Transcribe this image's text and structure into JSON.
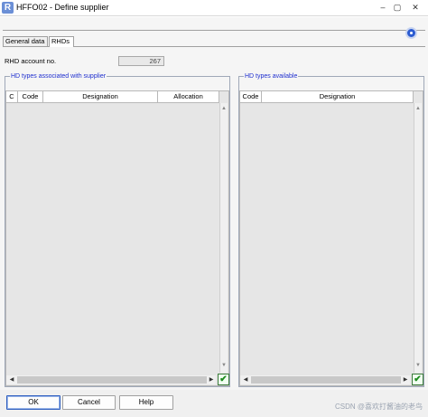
{
  "window": {
    "title": "HFFO02 - Define supplier",
    "app_icon": "R",
    "minimize_glyph": "–",
    "maximize_glyph": "▢",
    "close_glyph": "✕"
  },
  "tabs": [
    {
      "label": "General data"
    },
    {
      "label": "RHDs"
    }
  ],
  "account": {
    "label": "RHD account no.",
    "value": "267"
  },
  "left_group": {
    "title": "HD types associated with supplier",
    "columns": [
      "C",
      "Code",
      "Designation",
      "Allocation"
    ]
  },
  "right_group": {
    "title": "HD types available",
    "columns": [
      "Code",
      "Designation"
    ]
  },
  "buttons": {
    "ok": "OK",
    "cancel": "Cancel",
    "help": "Help"
  },
  "icons": {
    "check": "✔",
    "arrow_left": "◀",
    "arrow_right": "▶",
    "arrow_up": "▲",
    "arrow_down": "▼"
  },
  "watermark": "CSDN @喜欢打酱油的老鸟"
}
